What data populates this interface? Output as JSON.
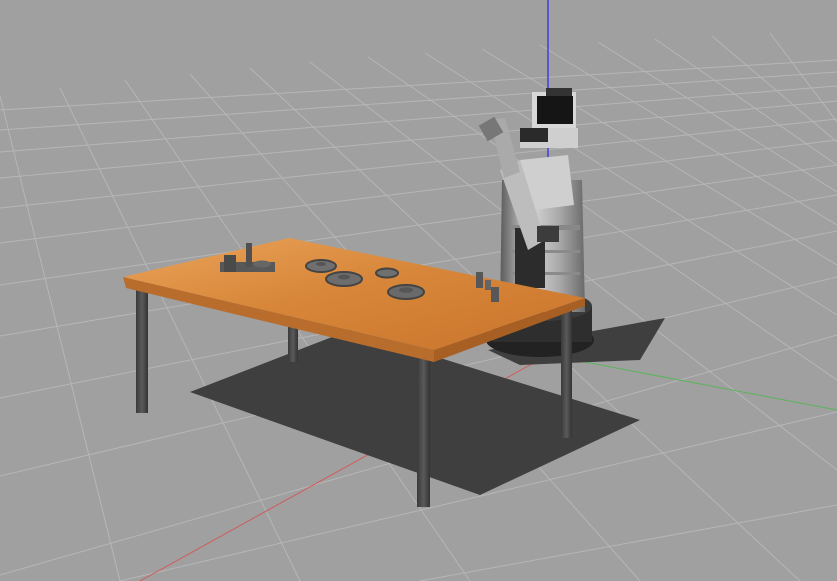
{
  "viewport": {
    "type": "3d-simulation-view",
    "background_color": "#a0a0a0",
    "grid_color": "#b4b4b4",
    "axis_colors": {
      "x": "#d25a5a",
      "y": "#5ab45a",
      "z": "#2828e6"
    }
  },
  "objects": [
    {
      "name": "table",
      "color": "#d98a3a"
    },
    {
      "name": "mobile-manipulator-robot",
      "color": "#b8b8b8"
    },
    {
      "name": "gear",
      "color": "#707070"
    },
    {
      "name": "peg",
      "color": "#555555"
    }
  ]
}
